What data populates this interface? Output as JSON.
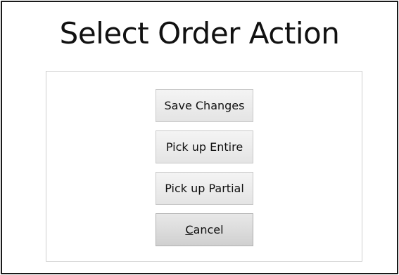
{
  "dialog": {
    "title": "Select Order Action"
  },
  "actions": {
    "save_changes": "Save Changes",
    "pick_up_entire": "Pick up Entire",
    "pick_up_partial": "Pick up Partial",
    "cancel_mnemonic": "C",
    "cancel_rest": "ancel"
  }
}
